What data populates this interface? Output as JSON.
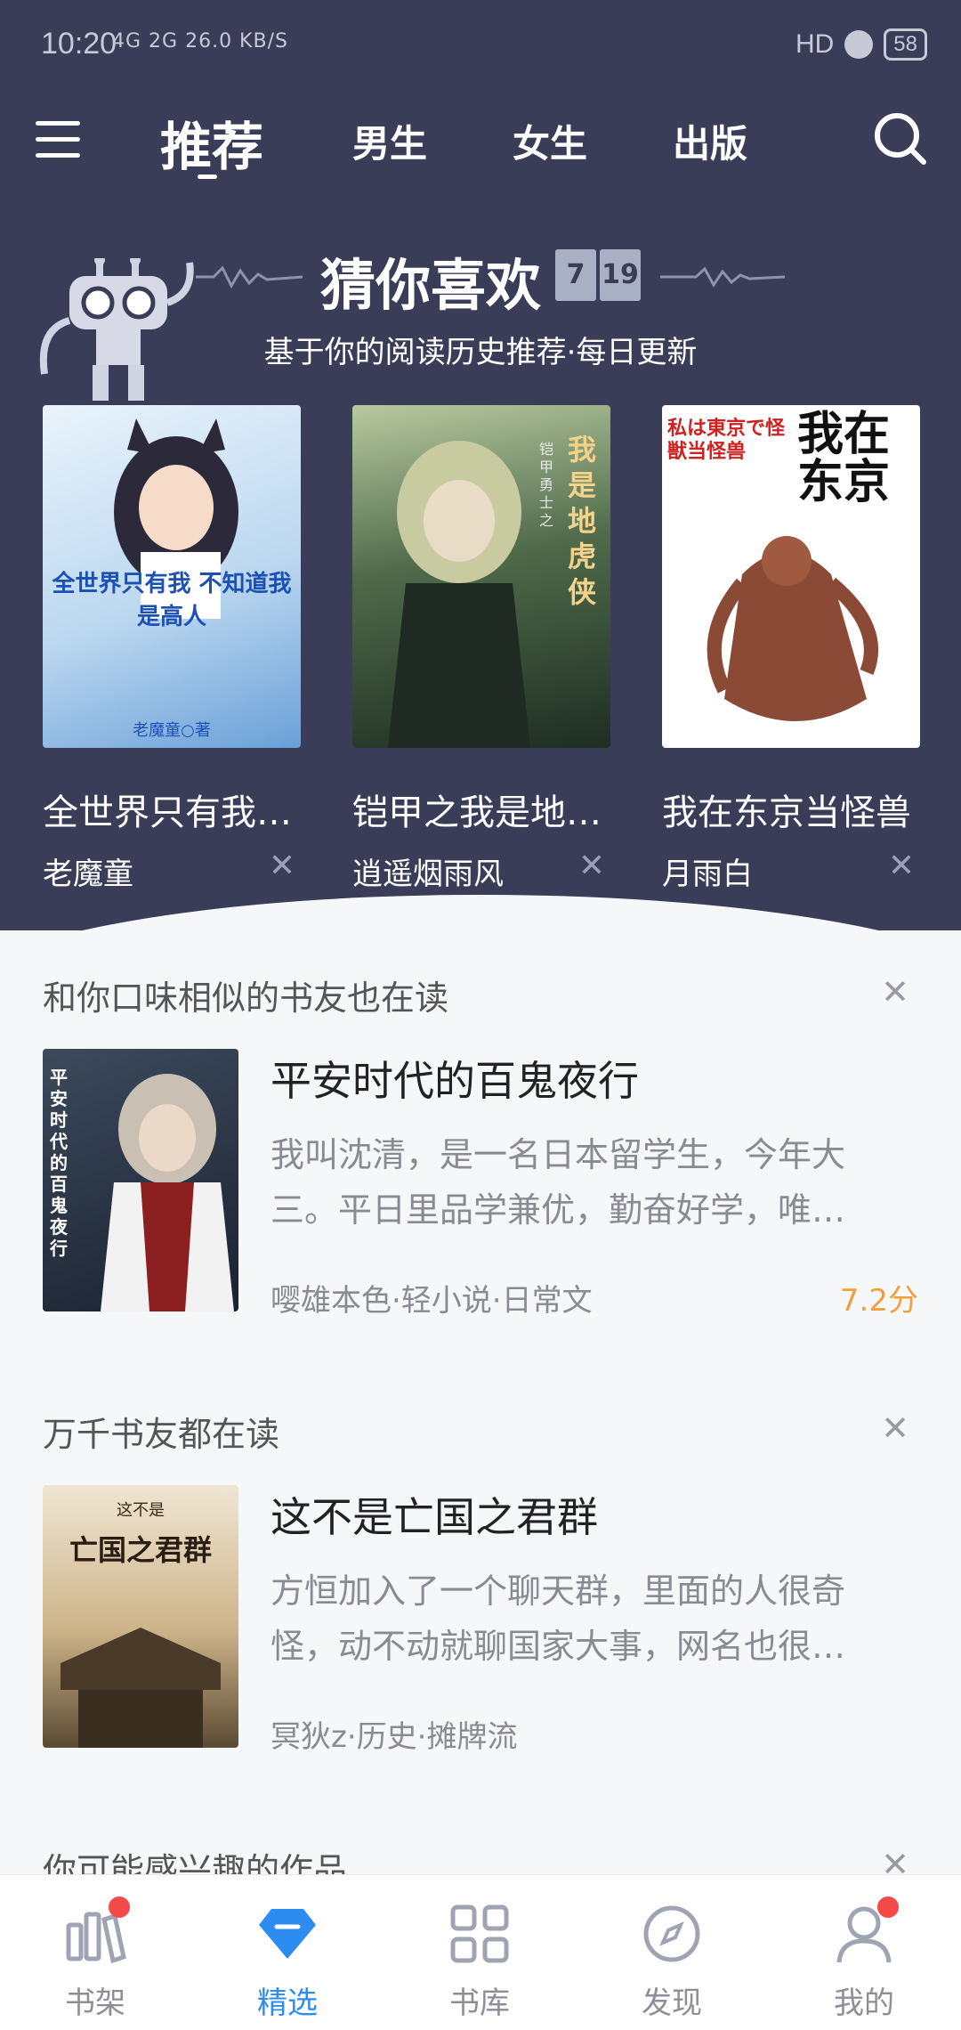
{
  "status_bar": {
    "time": "10:20",
    "network": "4G 2G 26.0 KB/S",
    "hd": "HD",
    "battery": "58"
  },
  "top_tabs": [
    {
      "label": "推荐",
      "active": true
    },
    {
      "label": "男生"
    },
    {
      "label": "女生"
    },
    {
      "label": "出版"
    }
  ],
  "guess": {
    "title": "猜你喜欢",
    "calendar": [
      "7",
      "19"
    ],
    "subtitle": "基于你的阅读历史推荐·每日更新",
    "books": [
      {
        "title": "全世界只有我不知道我是高人",
        "author": "老魔童",
        "cover_text": "全世界只有我 不知道我是高人",
        "cover_author": "老魔童○著"
      },
      {
        "title": "铠甲之我是地虎侠",
        "author": "逍遥烟雨风",
        "cover_text": "我是地虎侠",
        "cover_author": "铠甲勇士之"
      },
      {
        "title": "我在东京当怪兽",
        "author": "月雨白",
        "cover_text": "我在东京",
        "cover_author": "私は東京で怪獣当怪兽"
      }
    ]
  },
  "section_similar": {
    "heading": "和你口味相似的书友也在读",
    "book": {
      "title": "平安时代的百鬼夜行",
      "desc": "我叫沈清，是一名日本留学生，今年大三。平日里品学兼优，勤奋好学，唯…",
      "meta": "嘤雄本色·轻小说·日常文",
      "score": "7.2分",
      "cover_text": "平安时代的百鬼夜行"
    }
  },
  "section_popular": {
    "heading": "万千书友都在读",
    "book": {
      "title": "这不是亡国之君群",
      "desc": "方恒加入了一个聊天群，里面的人很奇怪，动不动就聊国家大事，网名也很…",
      "meta": "冥狄z·历史·摊牌流",
      "cover_text": "亡国之君群",
      "cover_top": "这不是"
    }
  },
  "section_interest": {
    "heading": "你可能感兴趣的作品"
  },
  "bottom_tabs": [
    {
      "label": "书架",
      "dot": true
    },
    {
      "label": "精选",
      "active": true
    },
    {
      "label": "书库"
    },
    {
      "label": "发现"
    },
    {
      "label": "我的",
      "dot": true
    }
  ],
  "colors": {
    "hero_bg": "#3a3d58",
    "accent_blue": "#2d8cf0",
    "score_orange": "#f0a040",
    "badge_red": "#f44a4a"
  }
}
